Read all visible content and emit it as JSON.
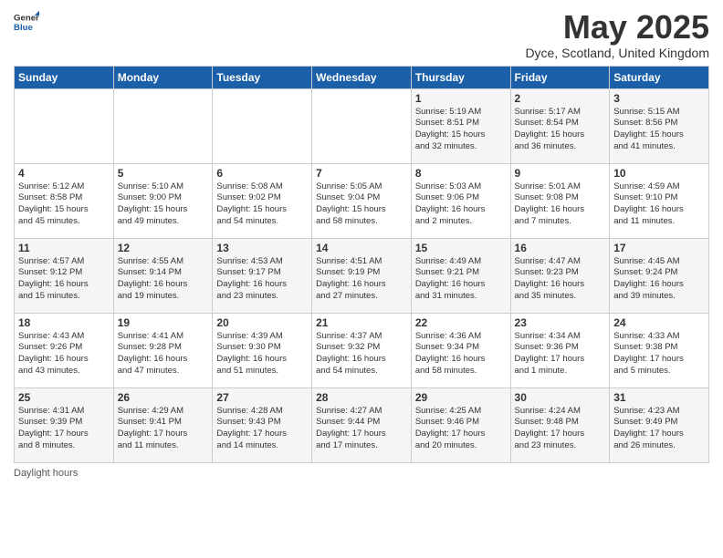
{
  "header": {
    "logo_general": "General",
    "logo_blue": "Blue",
    "month": "May 2025",
    "location": "Dyce, Scotland, United Kingdom"
  },
  "days_of_week": [
    "Sunday",
    "Monday",
    "Tuesday",
    "Wednesday",
    "Thursday",
    "Friday",
    "Saturday"
  ],
  "weeks": [
    [
      {
        "day": "",
        "content": ""
      },
      {
        "day": "",
        "content": ""
      },
      {
        "day": "",
        "content": ""
      },
      {
        "day": "",
        "content": ""
      },
      {
        "day": "1",
        "content": "Sunrise: 5:19 AM\nSunset: 8:51 PM\nDaylight: 15 hours\nand 32 minutes."
      },
      {
        "day": "2",
        "content": "Sunrise: 5:17 AM\nSunset: 8:54 PM\nDaylight: 15 hours\nand 36 minutes."
      },
      {
        "day": "3",
        "content": "Sunrise: 5:15 AM\nSunset: 8:56 PM\nDaylight: 15 hours\nand 41 minutes."
      }
    ],
    [
      {
        "day": "4",
        "content": "Sunrise: 5:12 AM\nSunset: 8:58 PM\nDaylight: 15 hours\nand 45 minutes."
      },
      {
        "day": "5",
        "content": "Sunrise: 5:10 AM\nSunset: 9:00 PM\nDaylight: 15 hours\nand 49 minutes."
      },
      {
        "day": "6",
        "content": "Sunrise: 5:08 AM\nSunset: 9:02 PM\nDaylight: 15 hours\nand 54 minutes."
      },
      {
        "day": "7",
        "content": "Sunrise: 5:05 AM\nSunset: 9:04 PM\nDaylight: 15 hours\nand 58 minutes."
      },
      {
        "day": "8",
        "content": "Sunrise: 5:03 AM\nSunset: 9:06 PM\nDaylight: 16 hours\nand 2 minutes."
      },
      {
        "day": "9",
        "content": "Sunrise: 5:01 AM\nSunset: 9:08 PM\nDaylight: 16 hours\nand 7 minutes."
      },
      {
        "day": "10",
        "content": "Sunrise: 4:59 AM\nSunset: 9:10 PM\nDaylight: 16 hours\nand 11 minutes."
      }
    ],
    [
      {
        "day": "11",
        "content": "Sunrise: 4:57 AM\nSunset: 9:12 PM\nDaylight: 16 hours\nand 15 minutes."
      },
      {
        "day": "12",
        "content": "Sunrise: 4:55 AM\nSunset: 9:14 PM\nDaylight: 16 hours\nand 19 minutes."
      },
      {
        "day": "13",
        "content": "Sunrise: 4:53 AM\nSunset: 9:17 PM\nDaylight: 16 hours\nand 23 minutes."
      },
      {
        "day": "14",
        "content": "Sunrise: 4:51 AM\nSunset: 9:19 PM\nDaylight: 16 hours\nand 27 minutes."
      },
      {
        "day": "15",
        "content": "Sunrise: 4:49 AM\nSunset: 9:21 PM\nDaylight: 16 hours\nand 31 minutes."
      },
      {
        "day": "16",
        "content": "Sunrise: 4:47 AM\nSunset: 9:23 PM\nDaylight: 16 hours\nand 35 minutes."
      },
      {
        "day": "17",
        "content": "Sunrise: 4:45 AM\nSunset: 9:24 PM\nDaylight: 16 hours\nand 39 minutes."
      }
    ],
    [
      {
        "day": "18",
        "content": "Sunrise: 4:43 AM\nSunset: 9:26 PM\nDaylight: 16 hours\nand 43 minutes."
      },
      {
        "day": "19",
        "content": "Sunrise: 4:41 AM\nSunset: 9:28 PM\nDaylight: 16 hours\nand 47 minutes."
      },
      {
        "day": "20",
        "content": "Sunrise: 4:39 AM\nSunset: 9:30 PM\nDaylight: 16 hours\nand 51 minutes."
      },
      {
        "day": "21",
        "content": "Sunrise: 4:37 AM\nSunset: 9:32 PM\nDaylight: 16 hours\nand 54 minutes."
      },
      {
        "day": "22",
        "content": "Sunrise: 4:36 AM\nSunset: 9:34 PM\nDaylight: 16 hours\nand 58 minutes."
      },
      {
        "day": "23",
        "content": "Sunrise: 4:34 AM\nSunset: 9:36 PM\nDaylight: 17 hours\nand 1 minute."
      },
      {
        "day": "24",
        "content": "Sunrise: 4:33 AM\nSunset: 9:38 PM\nDaylight: 17 hours\nand 5 minutes."
      }
    ],
    [
      {
        "day": "25",
        "content": "Sunrise: 4:31 AM\nSunset: 9:39 PM\nDaylight: 17 hours\nand 8 minutes."
      },
      {
        "day": "26",
        "content": "Sunrise: 4:29 AM\nSunset: 9:41 PM\nDaylight: 17 hours\nand 11 minutes."
      },
      {
        "day": "27",
        "content": "Sunrise: 4:28 AM\nSunset: 9:43 PM\nDaylight: 17 hours\nand 14 minutes."
      },
      {
        "day": "28",
        "content": "Sunrise: 4:27 AM\nSunset: 9:44 PM\nDaylight: 17 hours\nand 17 minutes."
      },
      {
        "day": "29",
        "content": "Sunrise: 4:25 AM\nSunset: 9:46 PM\nDaylight: 17 hours\nand 20 minutes."
      },
      {
        "day": "30",
        "content": "Sunrise: 4:24 AM\nSunset: 9:48 PM\nDaylight: 17 hours\nand 23 minutes."
      },
      {
        "day": "31",
        "content": "Sunrise: 4:23 AM\nSunset: 9:49 PM\nDaylight: 17 hours\nand 26 minutes."
      }
    ]
  ],
  "footer": {
    "daylight_hours_label": "Daylight hours"
  }
}
